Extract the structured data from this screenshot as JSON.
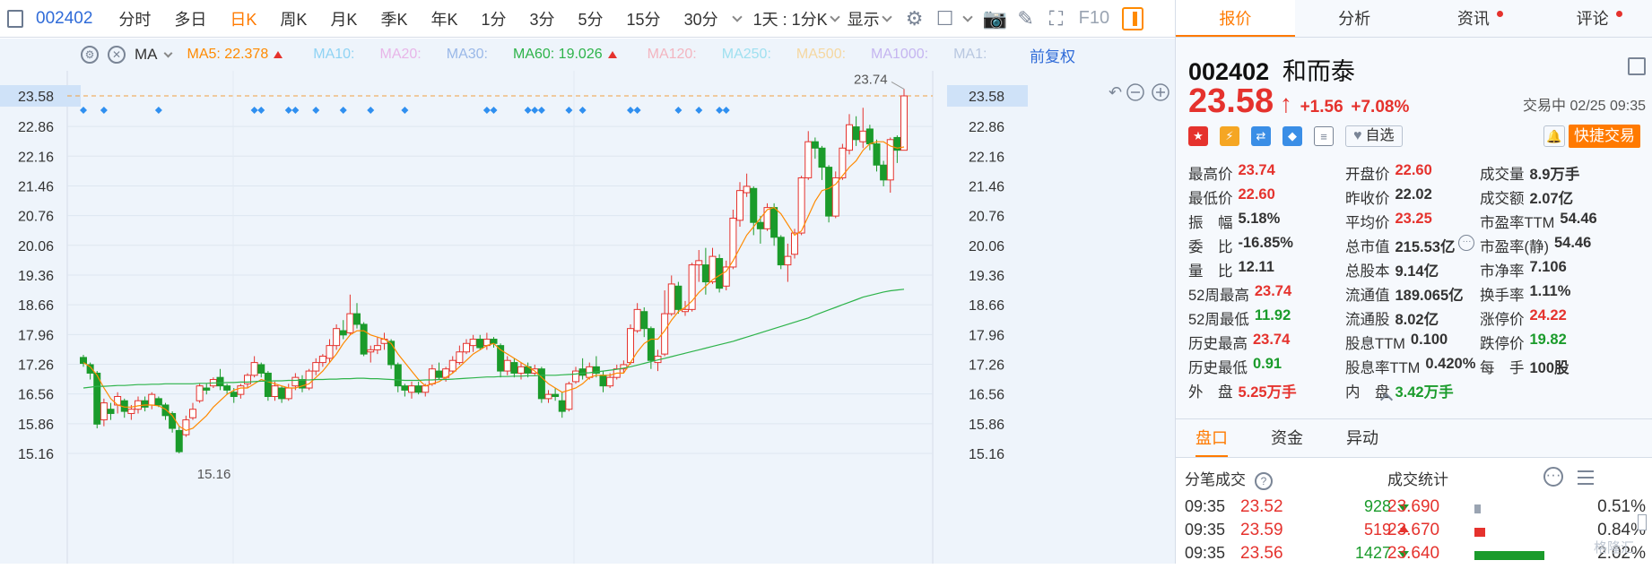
{
  "toolbar": {
    "code": "002402",
    "periods": [
      "分时",
      "多日",
      "日K",
      "周K",
      "月K",
      "季K",
      "年K",
      "1分",
      "3分",
      "5分",
      "15分",
      "30分"
    ],
    "active_period": "日K",
    "interval_select": "1天 : 1分K",
    "display_select": "显示",
    "f10": "F10"
  },
  "ma_bar": {
    "ma_label": "MA",
    "ma5": "MA5: 22.378",
    "ma10": "MA10:",
    "ma20": "MA20:",
    "ma30": "MA30:",
    "ma60": "MA60: 19.026",
    "ma120": "MA120:",
    "ma250": "MA250:",
    "ma500": "MA500:",
    "ma1000": "MA1000:",
    "ma1": "MA1:",
    "adjust": "前复权"
  },
  "colors": {
    "up": "#e5322d",
    "down": "#1a9b2b",
    "ma5": "#ff8a00",
    "ma60": "#2db34a",
    "accent": "#ff7a00",
    "link": "#2f6bd8"
  },
  "chart_data": {
    "type": "candlestick",
    "y_ticks": [
      "23.58",
      "22.86",
      "22.16",
      "21.46",
      "20.76",
      "20.06",
      "19.36",
      "18.66",
      "17.96",
      "17.26",
      "16.56",
      "15.86",
      "15.16"
    ],
    "ylim": [
      15.0,
      24.0
    ],
    "current_price": "23.58",
    "high_label": "23.74",
    "low_label": "15.16",
    "candles": [
      [
        17.42,
        17.28,
        17.48,
        17.2
      ],
      [
        17.25,
        17.05,
        17.3,
        16.9
      ],
      [
        17.05,
        15.85,
        17.1,
        15.75
      ],
      [
        15.95,
        16.35,
        16.45,
        15.8
      ],
      [
        16.2,
        16.1,
        16.35,
        15.95
      ],
      [
        16.3,
        16.5,
        16.6,
        16.1
      ],
      [
        16.4,
        16.15,
        16.45,
        16.0
      ],
      [
        16.1,
        16.2,
        16.3,
        15.95
      ],
      [
        16.2,
        16.4,
        16.5,
        16.1
      ],
      [
        16.4,
        16.25,
        16.5,
        16.15
      ],
      [
        16.3,
        16.55,
        16.6,
        16.2
      ],
      [
        16.45,
        16.3,
        16.5,
        16.25
      ],
      [
        16.3,
        16.05,
        16.35,
        15.95
      ],
      [
        16.1,
        15.75,
        16.15,
        15.65
      ],
      [
        15.7,
        15.2,
        15.8,
        15.16
      ],
      [
        15.6,
        15.95,
        16.05,
        15.55
      ],
      [
        16.0,
        16.2,
        16.35,
        15.95
      ],
      [
        16.4,
        16.75,
        16.8,
        16.35
      ],
      [
        16.7,
        16.65,
        16.8,
        16.55
      ],
      [
        16.75,
        16.9,
        16.95,
        16.7
      ],
      [
        16.95,
        16.75,
        17.15,
        16.65
      ],
      [
        16.75,
        16.65,
        16.8,
        16.55
      ],
      [
        16.6,
        16.5,
        16.7,
        16.35
      ],
      [
        16.55,
        16.75,
        16.8,
        16.45
      ],
      [
        16.8,
        17.0,
        17.05,
        16.7
      ],
      [
        17.0,
        17.3,
        17.45,
        16.95
      ],
      [
        17.25,
        17.05,
        17.3,
        16.95
      ],
      [
        17.05,
        16.5,
        17.1,
        16.4
      ],
      [
        16.5,
        16.75,
        16.85,
        16.4
      ],
      [
        16.7,
        16.45,
        16.75,
        16.35
      ],
      [
        16.45,
        16.7,
        16.8,
        16.4
      ],
      [
        16.75,
        16.95,
        17.05,
        16.65
      ],
      [
        16.9,
        16.7,
        17.0,
        16.6
      ],
      [
        16.7,
        17.1,
        17.15,
        16.65
      ],
      [
        17.1,
        17.3,
        17.4,
        17.0
      ],
      [
        17.3,
        17.45,
        17.5,
        17.2
      ],
      [
        17.4,
        17.7,
        17.85,
        17.3
      ],
      [
        17.7,
        18.1,
        18.2,
        17.6
      ],
      [
        18.05,
        17.95,
        18.3,
        17.85
      ],
      [
        18.0,
        18.45,
        18.9,
        17.95
      ],
      [
        18.45,
        18.2,
        18.7,
        18.1
      ],
      [
        18.2,
        17.5,
        18.25,
        17.45
      ],
      [
        17.55,
        17.6,
        17.7,
        17.3
      ],
      [
        17.6,
        17.7,
        17.9,
        17.5
      ],
      [
        17.75,
        17.85,
        18.0,
        17.6
      ],
      [
        17.8,
        17.25,
        17.85,
        17.15
      ],
      [
        17.25,
        16.75,
        17.3,
        16.6
      ],
      [
        16.75,
        16.65,
        16.8,
        16.5
      ],
      [
        16.6,
        16.75,
        16.85,
        16.45
      ],
      [
        16.75,
        16.6,
        16.85,
        16.55
      ],
      [
        16.6,
        16.75,
        16.8,
        16.5
      ],
      [
        16.8,
        17.15,
        17.25,
        16.75
      ],
      [
        17.1,
        16.95,
        17.3,
        16.9
      ],
      [
        16.95,
        17.15,
        17.2,
        16.85
      ],
      [
        17.1,
        17.35,
        17.45,
        17.05
      ],
      [
        17.3,
        17.55,
        17.7,
        17.25
      ],
      [
        17.55,
        17.75,
        17.85,
        17.5
      ],
      [
        17.7,
        17.85,
        17.95,
        17.55
      ],
      [
        17.85,
        17.65,
        17.95,
        17.6
      ],
      [
        17.7,
        17.85,
        18.0,
        17.6
      ],
      [
        17.85,
        17.75,
        17.9,
        17.65
      ],
      [
        17.7,
        17.1,
        17.75,
        16.95
      ],
      [
        17.1,
        17.35,
        17.45,
        17.0
      ],
      [
        17.3,
        17.05,
        17.4,
        16.95
      ],
      [
        17.05,
        17.2,
        17.3,
        16.9
      ],
      [
        17.2,
        17.05,
        17.3,
        16.95
      ],
      [
        17.05,
        17.15,
        17.25,
        17.0
      ],
      [
        17.15,
        16.45,
        17.2,
        16.35
      ],
      [
        16.45,
        16.55,
        16.65,
        16.35
      ],
      [
        16.55,
        16.5,
        16.7,
        16.4
      ],
      [
        16.4,
        16.15,
        16.6,
        16.0
      ],
      [
        16.2,
        16.8,
        16.85,
        16.15
      ],
      [
        16.85,
        17.1,
        17.2,
        16.8
      ],
      [
        17.15,
        17.0,
        17.4,
        16.9
      ],
      [
        16.95,
        17.2,
        17.3,
        16.9
      ],
      [
        17.2,
        17.05,
        17.45,
        16.95
      ],
      [
        17.0,
        16.75,
        17.1,
        16.6
      ],
      [
        16.75,
        16.95,
        17.05,
        16.7
      ],
      [
        16.95,
        17.15,
        17.25,
        16.9
      ],
      [
        17.15,
        17.25,
        17.35,
        17.05
      ],
      [
        17.3,
        18.1,
        18.2,
        17.25
      ],
      [
        18.05,
        18.55,
        18.7,
        18.0
      ],
      [
        18.5,
        18.1,
        18.6,
        17.9
      ],
      [
        18.1,
        17.35,
        18.15,
        17.15
      ],
      [
        17.3,
        17.45,
        17.6,
        17.1
      ],
      [
        17.5,
        18.45,
        19.0,
        17.45
      ],
      [
        18.45,
        19.15,
        19.35,
        18.4
      ],
      [
        19.1,
        18.55,
        19.2,
        18.45
      ],
      [
        18.5,
        18.55,
        18.75,
        18.4
      ],
      [
        18.55,
        19.6,
        19.65,
        18.5
      ],
      [
        19.6,
        19.7,
        19.95,
        19.2
      ],
      [
        19.6,
        19.2,
        20.0,
        18.9
      ],
      [
        19.2,
        19.8,
        20.0,
        19.15
      ],
      [
        19.75,
        19.05,
        19.85,
        18.95
      ],
      [
        19.1,
        19.55,
        19.7,
        19.0
      ],
      [
        19.55,
        20.7,
        20.9,
        19.5
      ],
      [
        20.65,
        21.35,
        21.55,
        20.5
      ],
      [
        21.3,
        21.45,
        21.75,
        21.2
      ],
      [
        21.4,
        20.6,
        21.45,
        20.3
      ],
      [
        20.6,
        20.45,
        20.75,
        20.1
      ],
      [
        20.45,
        20.95,
        21.05,
        20.4
      ],
      [
        20.95,
        20.25,
        21.05,
        20.05
      ],
      [
        20.25,
        19.6,
        20.3,
        19.5
      ],
      [
        19.6,
        19.8,
        20.1,
        19.2
      ],
      [
        19.85,
        20.35,
        20.45,
        19.75
      ],
      [
        20.35,
        21.65,
        21.7,
        20.3
      ],
      [
        21.65,
        22.5,
        22.75,
        21.6
      ],
      [
        22.5,
        22.35,
        22.6,
        22.1
      ],
      [
        22.35,
        21.9,
        22.4,
        21.6
      ],
      [
        21.9,
        20.75,
        21.95,
        20.6
      ],
      [
        20.75,
        21.65,
        21.8,
        20.7
      ],
      [
        21.65,
        22.35,
        22.45,
        21.6
      ],
      [
        22.3,
        22.9,
        23.15,
        22.2
      ],
      [
        22.85,
        22.55,
        23.1,
        22.4
      ],
      [
        22.5,
        22.75,
        23.3,
        22.35
      ],
      [
        22.8,
        22.45,
        22.9,
        22.3
      ],
      [
        22.45,
        21.95,
        22.55,
        21.8
      ],
      [
        21.95,
        21.6,
        22.05,
        21.45
      ],
      [
        21.6,
        22.55,
        22.6,
        21.3
      ],
      [
        22.6,
        22.3,
        22.65,
        22.0
      ],
      [
        22.3,
        23.58,
        23.74,
        22.3
      ]
    ],
    "ma5": [
      17.3,
      17.2,
      17.0,
      16.7,
      16.45,
      16.3,
      16.25,
      16.25,
      16.28,
      16.3,
      16.3,
      16.28,
      16.2,
      16.05,
      15.8,
      15.7,
      15.75,
      15.9,
      16.05,
      16.25,
      16.4,
      16.55,
      16.65,
      16.7,
      16.7,
      16.8,
      16.9,
      16.85,
      16.8,
      16.75,
      16.7,
      16.7,
      16.75,
      16.8,
      16.95,
      17.1,
      17.3,
      17.5,
      17.75,
      17.95,
      18.05,
      18.05,
      17.95,
      17.9,
      17.85,
      17.75,
      17.5,
      17.3,
      17.1,
      16.9,
      16.75,
      16.8,
      16.85,
      16.95,
      17.05,
      17.2,
      17.35,
      17.5,
      17.6,
      17.7,
      17.75,
      17.6,
      17.5,
      17.4,
      17.3,
      17.2,
      17.1,
      16.95,
      16.8,
      16.7,
      16.6,
      16.65,
      16.7,
      16.8,
      16.95,
      17.0,
      17.0,
      17.0,
      17.05,
      17.05,
      17.3,
      17.55,
      17.75,
      17.85,
      17.85,
      18.05,
      18.3,
      18.5,
      18.6,
      18.75,
      18.95,
      19.1,
      19.25,
      19.35,
      19.45,
      19.7,
      20.0,
      20.3,
      20.5,
      20.7,
      20.9,
      20.95,
      20.8,
      20.55,
      20.3,
      20.4,
      20.75,
      21.1,
      21.35,
      21.4,
      21.5,
      21.7,
      21.9,
      22.05,
      22.3,
      22.45,
      22.5,
      22.5,
      22.4,
      22.35,
      22.378
    ],
    "ma60": [
      16.7,
      16.72,
      16.74,
      16.74,
      16.75,
      16.76,
      16.76,
      16.77,
      16.78,
      16.78,
      16.79,
      16.79,
      16.8,
      16.8,
      16.8,
      16.8,
      16.8,
      16.81,
      16.81,
      16.82,
      16.82,
      16.83,
      16.83,
      16.84,
      16.84,
      16.85,
      16.86,
      16.86,
      16.87,
      16.87,
      16.88,
      16.88,
      16.89,
      16.89,
      16.9,
      16.9,
      16.91,
      16.91,
      16.92,
      16.92,
      16.93,
      16.93,
      16.92,
      16.92,
      16.91,
      16.9,
      16.89,
      16.88,
      16.88,
      16.88,
      16.89,
      16.89,
      16.9,
      16.9,
      16.91,
      16.92,
      16.93,
      16.94,
      16.95,
      16.96,
      16.96,
      16.97,
      16.97,
      16.98,
      16.98,
      16.99,
      16.99,
      17.0,
      17.0,
      17.0,
      17.01,
      17.02,
      17.03,
      17.05,
      17.06,
      17.08,
      17.1,
      17.12,
      17.14,
      17.17,
      17.2,
      17.24,
      17.28,
      17.32,
      17.36,
      17.4,
      17.44,
      17.48,
      17.52,
      17.56,
      17.6,
      17.64,
      17.68,
      17.72,
      17.76,
      17.8,
      17.85,
      17.9,
      17.95,
      18.0,
      18.05,
      18.1,
      18.15,
      18.2,
      18.25,
      18.3,
      18.35,
      18.42,
      18.48,
      18.54,
      18.6,
      18.66,
      18.72,
      18.78,
      18.84,
      18.88,
      18.92,
      18.96,
      18.99,
      19.01,
      19.026
    ]
  },
  "tabs": [
    "报价",
    "分析",
    "资讯",
    "评论"
  ],
  "stock": {
    "code": "002402",
    "name": "和而泰",
    "price": "23.58",
    "change": "+1.56",
    "change_pct": "+7.08%",
    "status_time": "交易中 02/25 09:35",
    "watch_label": "自选",
    "quick_trade": "快捷交易"
  },
  "stats": [
    [
      {
        "label": "最高价",
        "value": "23.74",
        "color": "red"
      },
      {
        "label": "开盘价",
        "value": "22.60",
        "color": "red"
      },
      {
        "label": "成交量",
        "value": "8.9万手",
        "color": ""
      }
    ],
    [
      {
        "label": "最低价",
        "value": "22.60",
        "color": "red"
      },
      {
        "label": "昨收价",
        "value": "22.02",
        "color": ""
      },
      {
        "label": "成交额",
        "value": "2.07亿",
        "color": ""
      }
    ],
    [
      {
        "label": "振　幅",
        "value": "5.18%",
        "color": ""
      },
      {
        "label": "平均价",
        "value": "23.25",
        "color": "red"
      },
      {
        "label": "市盈率TTM",
        "value": "54.46",
        "color": ""
      }
    ],
    [
      {
        "label": "委　比",
        "value": "-16.85%",
        "color": ""
      },
      {
        "label": "总市值",
        "value": "215.53亿",
        "color": ""
      },
      {
        "label": "市盈率(静)",
        "value": "54.46",
        "color": ""
      }
    ],
    [
      {
        "label": "量　比",
        "value": "12.11",
        "color": ""
      },
      {
        "label": "总股本",
        "value": "9.14亿",
        "color": ""
      },
      {
        "label": "市净率",
        "value": "7.106",
        "color": ""
      }
    ],
    [
      {
        "label": "52周最高",
        "value": "23.74",
        "color": "red"
      },
      {
        "label": "流通值",
        "value": "189.065亿",
        "color": ""
      },
      {
        "label": "换手率",
        "value": "1.11%",
        "color": ""
      }
    ],
    [
      {
        "label": "52周最低",
        "value": "11.92",
        "color": "green"
      },
      {
        "label": "流通股",
        "value": "8.02亿",
        "color": ""
      },
      {
        "label": "涨停价",
        "value": "24.22",
        "color": "red"
      }
    ],
    [
      {
        "label": "历史最高",
        "value": "23.74",
        "color": "red"
      },
      {
        "label": "股息TTM",
        "value": "0.100",
        "color": ""
      },
      {
        "label": "跌停价",
        "value": "19.82",
        "color": "green"
      }
    ],
    [
      {
        "label": "历史最低",
        "value": "0.91",
        "color": "green"
      },
      {
        "label": "股息率TTM",
        "value": "0.420%",
        "color": ""
      },
      {
        "label": "每　手",
        "value": "100股",
        "color": ""
      }
    ],
    [
      {
        "label": "外　盘",
        "value": "5.25万手",
        "color": "red"
      },
      {
        "label": "内　盘",
        "value": "3.42万手",
        "color": "green"
      },
      {
        "label": "",
        "value": "",
        "color": ""
      }
    ]
  ],
  "sub_tabs": [
    "盘口",
    "资金",
    "异动"
  ],
  "fenbi": {
    "title": "分笔成交",
    "stats_title": "成交统计",
    "trades": [
      {
        "time": "09:35",
        "price": "23.52",
        "vol": "928",
        "dir": "down"
      },
      {
        "time": "09:35",
        "price": "23.59",
        "vol": "519",
        "dir": "up"
      },
      {
        "time": "09:35",
        "price": "23.56",
        "vol": "1427",
        "dir": "down"
      }
    ],
    "dist": [
      {
        "price": "23.690",
        "pct": "0.51%",
        "frac": 0.05
      },
      {
        "price": "23.670",
        "pct": "0.84%",
        "frac": 0.09
      },
      {
        "price": "23.640",
        "pct": "2.02%",
        "frac": 0.6
      }
    ]
  },
  "watermark": "格隆汇"
}
